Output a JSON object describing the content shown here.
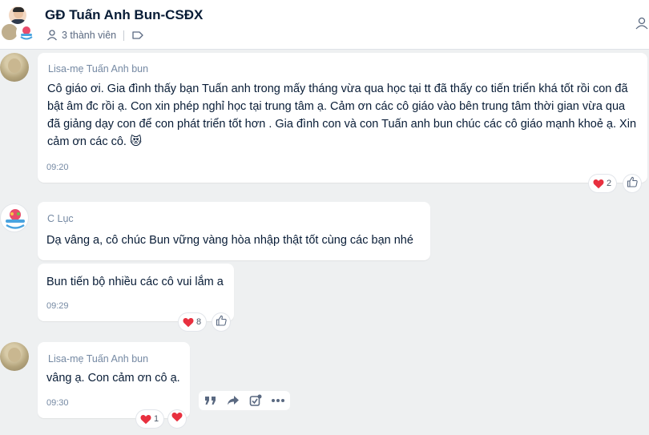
{
  "header": {
    "title": "GĐ Tuấn Anh Bun-CSĐX",
    "members": "3 thành viên"
  },
  "messages": [
    {
      "sender": "Lisa-mẹ Tuấn Anh bun",
      "text": "Cô giáo ơi. Gia đình thấy bạn Tuấn anh trong mấy tháng vừa qua học tại tt đã thấy co tiến triển khá tốt rồi con đã bật âm đc rồi ạ. Con xin phép nghỉ học tại trung tâm ạ. Cảm ơn các cô giáo vào bên trung tâm thời gian vừa qua đã giảng dạy con để con phát triển tốt hơn . Gia đình con và con Tuấn anh bun chúc các cô giáo mạnh khoẻ ạ. Xin cảm ơn các cô. 😻",
      "time": "09:20",
      "reaction_count": "2"
    },
    {
      "sender": "C Lục",
      "text": "Dạ vâng a,  cô chúc Bun  vững vàng hòa nhập thật tốt cùng các bạn nhé"
    },
    {
      "text": "Bun tiến bộ nhiều các cô vui lắm a",
      "time": "09:29",
      "reaction_count": "8"
    },
    {
      "sender": "Lisa-mẹ Tuấn Anh bun",
      "text": "vâng ạ. Con cảm ơn cô ạ.",
      "time": "09:30",
      "reaction_count": "1"
    }
  ],
  "colors": {
    "heart": "#e8303f",
    "accent": "#005ae0",
    "background": "#eef0f1"
  }
}
